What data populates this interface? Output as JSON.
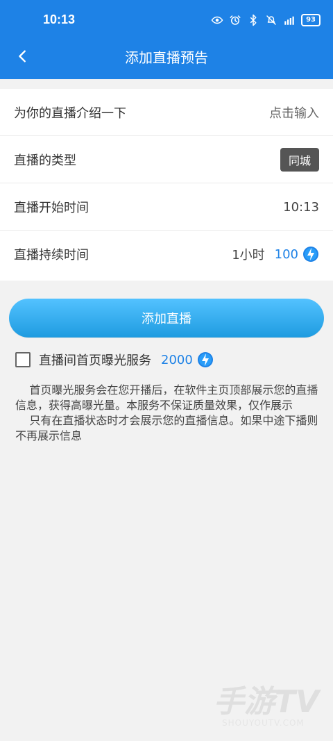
{
  "status_bar": {
    "time": "10:13",
    "battery": "93"
  },
  "app_bar": {
    "title": "添加直播预告"
  },
  "rows": {
    "intro": {
      "label": "为你的直播介绍一下",
      "value": "点击输入"
    },
    "type": {
      "label": "直播的类型",
      "value": "同城"
    },
    "start_time": {
      "label": "直播开始时间",
      "value": "10:13"
    },
    "duration": {
      "label": "直播持续时间",
      "value": "1小时",
      "cost": "100"
    }
  },
  "primary_button": {
    "label": "添加直播"
  },
  "exposure_service": {
    "label": "直播间首页曝光服务",
    "cost": "2000",
    "checked": false
  },
  "description": "    首页曝光服务会在您开播后，在软件主页顶部展示您的直播信息，获得高曝光量。本服务不保证质量效果，仅作展示\n    只有在直播状态时才会展示您的直播信息。如果中途下播则不再展示信息",
  "watermark": {
    "text": "手游TV",
    "subtext": "SHOUYOUTV.COM"
  },
  "colors": {
    "accent": "#1e82e6",
    "button_gradient_top": "#53c2ff",
    "button_gradient_bottom": "#1e9be0",
    "pill_bg": "#555555"
  },
  "icons": {
    "back": "chevron-left-icon",
    "coin": "lightning-coin-icon",
    "eye": "eye-icon",
    "alarm": "alarm-icon",
    "bluetooth": "bluetooth-icon",
    "mute": "bell-off-icon",
    "signal": "signal-icon"
  }
}
